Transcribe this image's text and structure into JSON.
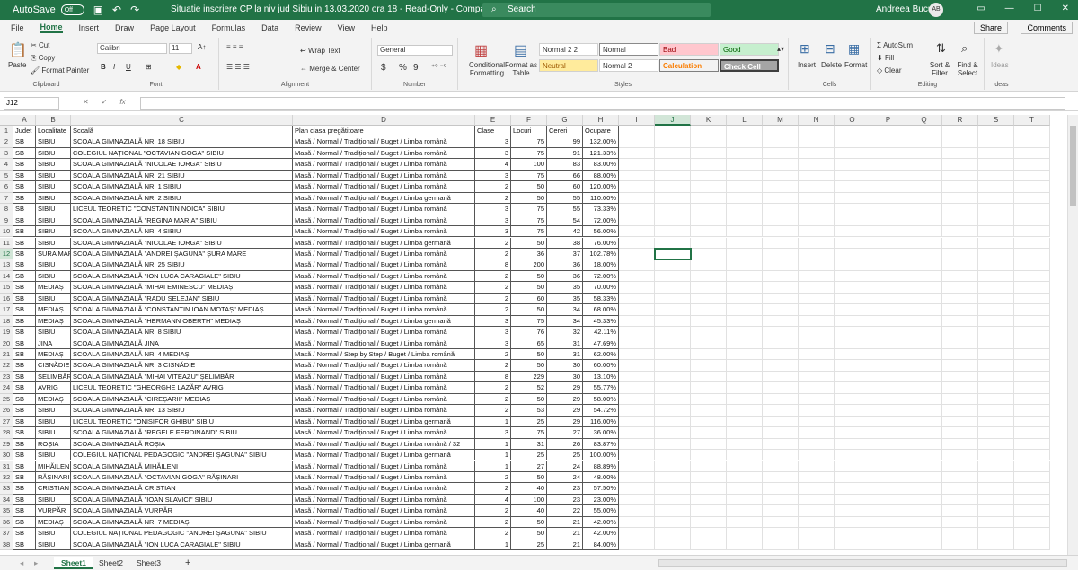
{
  "titlebar": {
    "autosave_label": "AutoSave",
    "autosave_state": "Off",
    "doc_title": "Situatie inscriere CP la niv jud Sibiu in 13.03.2020 ora 18  -  Read-Only  -  Compatibility Mode  -  Excel",
    "search_placeholder": "Search",
    "user_name": "Andreea Bucur",
    "user_initials": "AB"
  },
  "menu": {
    "tabs": [
      "File",
      "Home",
      "Insert",
      "Draw",
      "Page Layout",
      "Formulas",
      "Data",
      "Review",
      "View",
      "Help"
    ],
    "active": "Home",
    "share": "Share",
    "comments": "Comments"
  },
  "ribbon": {
    "clipboard": {
      "label": "Clipboard",
      "paste": "Paste",
      "cut": "Cut",
      "copy": "Copy",
      "format_painter": "Format Painter"
    },
    "font": {
      "label": "Font",
      "name": "Calibri",
      "size": "11",
      "bold": "B",
      "italic": "I",
      "underline": "U"
    },
    "alignment": {
      "label": "Alignment",
      "wrap": "Wrap Text",
      "merge": "Merge & Center"
    },
    "number": {
      "label": "Number",
      "format": "General",
      "currency": "$",
      "percent": "%",
      "comma": "9"
    },
    "styles": {
      "label": "Styles",
      "conditional": "Conditional Formatting",
      "format_table": "Format as Table",
      "boxes": [
        "Normal 2 2",
        "Normal",
        "Bad",
        "Good",
        "Neutral",
        "Normal 2",
        "Calculation",
        "Check Cell"
      ]
    },
    "cells": {
      "label": "Cells",
      "insert": "Insert",
      "delete": "Delete",
      "format": "Format"
    },
    "editing": {
      "label": "Editing",
      "autosum": "AutoSum",
      "fill": "Fill",
      "clear": "Clear",
      "sort": "Sort & Filter",
      "find": "Find & Select"
    },
    "ideas": {
      "label": "Ideas",
      "ideas": "Ideas"
    }
  },
  "formula": {
    "namebox": "J12",
    "fx": "fx",
    "value": ""
  },
  "sheet": {
    "columns": [
      "A",
      "B",
      "C",
      "D",
      "E",
      "F",
      "G",
      "H",
      "I",
      "J",
      "K",
      "L",
      "M",
      "N",
      "O",
      "P",
      "Q",
      "R",
      "S",
      "T"
    ],
    "selected_col": "J",
    "selected_row": 12,
    "headers": [
      "Județ",
      "Localitate",
      "Școală",
      "Plan clasa pregătitoare",
      "Clase",
      "Locuri",
      "Cereri",
      "Ocupare"
    ],
    "rows": [
      [
        "SB",
        "SIBIU",
        "ȘCOALA GIMNAZIALĂ NR. 18 SIBIU",
        "Masă / Normal / Tradițional / Buget / Limba română",
        "3",
        "75",
        "99",
        "132.00%"
      ],
      [
        "SB",
        "SIBIU",
        "COLEGIUL NAȚIONAL \"OCTAVIAN GOGA\" SIBIU",
        "Masă / Normal / Tradițional / Buget / Limba română",
        "3",
        "75",
        "91",
        "121.33%"
      ],
      [
        "SB",
        "SIBIU",
        "ȘCOALA GIMNAZIALĂ \"NICOLAE IORGA\" SIBIU",
        "Masă / Normal / Tradițional / Buget / Limba română",
        "4",
        "100",
        "83",
        "83.00%"
      ],
      [
        "SB",
        "SIBIU",
        "ȘCOALA GIMNAZIALĂ NR. 21 SIBIU",
        "Masă / Normal / Tradițional / Buget / Limba română",
        "3",
        "75",
        "66",
        "88.00%"
      ],
      [
        "SB",
        "SIBIU",
        "ȘCOALA GIMNAZIALĂ NR. 1 SIBIU",
        "Masă / Normal / Tradițional / Buget / Limba română",
        "2",
        "50",
        "60",
        "120.00%"
      ],
      [
        "SB",
        "SIBIU",
        "ȘCOALA GIMNAZIALĂ NR. 2 SIBIU",
        "Masă / Normal / Tradițional / Buget / Limba germană",
        "2",
        "50",
        "55",
        "110.00%"
      ],
      [
        "SB",
        "SIBIU",
        "LICEUL TEORETIC \"CONSTANTIN NOICA\" SIBIU",
        "Masă / Normal / Tradițional / Buget / Limba română",
        "3",
        "75",
        "55",
        "73.33%"
      ],
      [
        "SB",
        "SIBIU",
        "ȘCOALA GIMNAZIALĂ \"REGINA MARIA\" SIBIU",
        "Masă / Normal / Tradițional / Buget / Limba română",
        "3",
        "75",
        "54",
        "72.00%"
      ],
      [
        "SB",
        "SIBIU",
        "ȘCOALA GIMNAZIALĂ NR. 4 SIBIU",
        "Masă / Normal / Tradițional / Buget / Limba română",
        "3",
        "75",
        "42",
        "56.00%"
      ],
      [
        "SB",
        "SIBIU",
        "ȘCOALA GIMNAZIALĂ \"NICOLAE IORGA\" SIBIU",
        "Masă / Normal / Tradițional / Buget / Limba germană",
        "2",
        "50",
        "38",
        "76.00%"
      ],
      [
        "SB",
        "ȘURA MARE",
        "ȘCOALA GIMNAZIALĂ \"ANDREI ȘAGUNA\" ȘURA MARE",
        "Masă / Normal / Tradițional / Buget / Limba română",
        "2",
        "36",
        "37",
        "102.78%"
      ],
      [
        "SB",
        "SIBIU",
        "ȘCOALA GIMNAZIALĂ NR. 25 SIBIU",
        "Masă / Normal / Tradițional / Buget / Limba română",
        "8",
        "200",
        "36",
        "18.00%"
      ],
      [
        "SB",
        "SIBIU",
        "ȘCOALA GIMNAZIALĂ \"ION LUCA CARAGIALE\" SIBIU",
        "Masă / Normal / Tradițional / Buget / Limba română",
        "2",
        "50",
        "36",
        "72.00%"
      ],
      [
        "SB",
        "MEDIAȘ",
        "ȘCOALA GIMNAZIALĂ \"MIHAI EMINESCU\" MEDIAȘ",
        "Masă / Normal / Tradițional / Buget / Limba română",
        "2",
        "50",
        "35",
        "70.00%"
      ],
      [
        "SB",
        "SIBIU",
        "ȘCOALA GIMNAZIALĂ \"RADU SELEJAN\" SIBIU",
        "Masă / Normal / Tradițional / Buget / Limba română",
        "2",
        "60",
        "35",
        "58.33%"
      ],
      [
        "SB",
        "MEDIAȘ",
        "ȘCOALA GIMNAZIALĂ \"CONSTANTIN IOAN MOTAȘ\" MEDIAȘ",
        "Masă / Normal / Tradițional / Buget / Limba română",
        "2",
        "50",
        "34",
        "68.00%"
      ],
      [
        "SB",
        "MEDIAȘ",
        "ȘCOALA GIMNAZIALĂ \"HERMANN OBERTH\" MEDIAȘ",
        "Masă / Normal / Tradițional / Buget / Limba germană",
        "3",
        "75",
        "34",
        "45.33%"
      ],
      [
        "SB",
        "SIBIU",
        "ȘCOALA GIMNAZIALĂ NR. 8 SIBIU",
        "Masă / Normal / Tradițional / Buget / Limba română",
        "3",
        "76",
        "32",
        "42.11%"
      ],
      [
        "SB",
        "JINA",
        "ȘCOALA GIMNAZIALĂ JINA",
        "Masă / Normal / Tradițional / Buget / Limba română",
        "3",
        "65",
        "31",
        "47.69%"
      ],
      [
        "SB",
        "MEDIAȘ",
        "ȘCOALA GIMNAZIALĂ NR. 4 MEDIAȘ",
        "Masă / Normal / Step by Step / Buget / Limba română",
        "2",
        "50",
        "31",
        "62.00%"
      ],
      [
        "SB",
        "CISNĂDIE",
        "ȘCOALA GIMNAZIALĂ NR. 3 CISNĂDIE",
        "Masă / Normal / Tradițional / Buget / Limba română",
        "2",
        "50",
        "30",
        "60.00%"
      ],
      [
        "SB",
        "ȘELIMBĂR",
        "ȘCOALA GIMNAZIALĂ \"MIHAI VITEAZU\" ȘELIMBĂR",
        "Masă / Normal / Tradițional / Buget / Limba română",
        "8",
        "229",
        "30",
        "13.10%"
      ],
      [
        "SB",
        "AVRIG",
        "LICEUL TEORETIC \"GHEORGHE LAZĂR\" AVRIG",
        "Masă / Normal / Tradițional / Buget / Limba română",
        "2",
        "52",
        "29",
        "55.77%"
      ],
      [
        "SB",
        "MEDIAȘ",
        "ȘCOALA GIMNAZIALĂ \"CIREȘARII\" MEDIAȘ",
        "Masă / Normal / Tradițional / Buget / Limba română",
        "2",
        "50",
        "29",
        "58.00%"
      ],
      [
        "SB",
        "SIBIU",
        "ȘCOALA GIMNAZIALĂ NR. 13 SIBIU",
        "Masă / Normal / Tradițional / Buget / Limba română",
        "2",
        "53",
        "29",
        "54.72%"
      ],
      [
        "SB",
        "SIBIU",
        "LICEUL TEORETIC \"ONISIFOR GHIBU\" SIBIU",
        "Masă / Normal / Tradițional / Buget / Limba germană",
        "1",
        "25",
        "29",
        "116.00%"
      ],
      [
        "SB",
        "SIBIU",
        "ȘCOALA GIMNAZIALĂ \"REGELE FERDINAND\" SIBIU",
        "Masă / Normal / Tradițional / Buget / Limba română",
        "3",
        "75",
        "27",
        "36.00%"
      ],
      [
        "SB",
        "ROȘIA",
        "ȘCOALA GIMNAZIALĂ ROȘIA",
        "Masă / Normal / Tradițional / Buget / Limba română / 32",
        "1",
        "31",
        "26",
        "83.87%"
      ],
      [
        "SB",
        "SIBIU",
        "COLEGIUL NAȚIONAL PEDAGOGIC \"ANDREI ȘAGUNA\" SIBIU",
        "Masă / Normal / Tradițional / Buget / Limba germană",
        "1",
        "25",
        "25",
        "100.00%"
      ],
      [
        "SB",
        "MIHĂILENI",
        "ȘCOALA GIMNAZIALĂ MIHĂILENI",
        "Masă / Normal / Tradițional / Buget / Limba română",
        "1",
        "27",
        "24",
        "88.89%"
      ],
      [
        "SB",
        "RĂȘINARI",
        "ȘCOALA GIMNAZIALĂ \"OCTAVIAN GOGA\" RĂȘINARI",
        "Masă / Normal / Tradițional / Buget / Limba română",
        "2",
        "50",
        "24",
        "48.00%"
      ],
      [
        "SB",
        "CRISTIAN",
        "ȘCOALA GIMNAZIALĂ CRISTIAN",
        "Masă / Normal / Tradițional / Buget / Limba română",
        "2",
        "40",
        "23",
        "57.50%"
      ],
      [
        "SB",
        "SIBIU",
        "ȘCOALA GIMNAZIALĂ \"IOAN SLAVICI\" SIBIU",
        "Masă / Normal / Tradițional / Buget / Limba română",
        "4",
        "100",
        "23",
        "23.00%"
      ],
      [
        "SB",
        "VURPĂR",
        "ȘCOALA GIMNAZIALĂ VURPĂR",
        "Masă / Normal / Tradițional / Buget / Limba română",
        "2",
        "40",
        "22",
        "55.00%"
      ],
      [
        "SB",
        "MEDIAȘ",
        "ȘCOALA GIMNAZIALĂ NR. 7 MEDIAȘ",
        "Masă / Normal / Tradițional / Buget / Limba română",
        "2",
        "50",
        "21",
        "42.00%"
      ],
      [
        "SB",
        "SIBIU",
        "COLEGIUL NAȚIONAL PEDAGOGIC \"ANDREI ȘAGUNA\" SIBIU",
        "Masă / Normal / Tradițional / Buget / Limba română",
        "2",
        "50",
        "21",
        "42.00%"
      ],
      [
        "SB",
        "SIBIU",
        "ȘCOALA GIMNAZIALĂ \"ION LUCA CARAGIALE\" SIBIU",
        "Masă / Normal / Tradițional / Buget / Limba germană",
        "1",
        "25",
        "21",
        "84.00%"
      ]
    ]
  },
  "tabs": {
    "sheets": [
      "Sheet1",
      "Sheet2",
      "Sheet3"
    ],
    "active": "Sheet1",
    "add": "+"
  },
  "colors": {
    "accent": "#217346"
  }
}
